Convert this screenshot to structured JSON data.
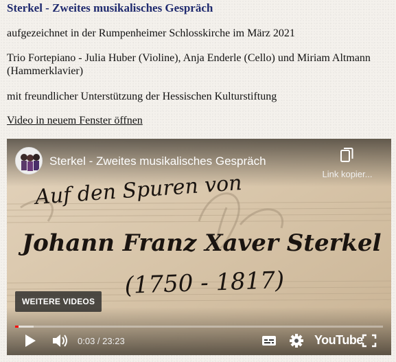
{
  "page": {
    "heading": "Sterkel - Zweites musikalisches Gespräch",
    "recorded": "aufgezeichnet in der Rumpenheimer Schlosskirche im März 2021",
    "performers": "Trio Fortepiano - Julia Huber (Violine), Anja Enderle (Cello) und Miriam Altmann (Hammerklavier)",
    "support": "mit freundlicher Unterstützung der Hessischen Kulturstiftung",
    "open_link": "Video in neuem Fenster öffnen"
  },
  "player": {
    "title": "Sterkel - Zweites musikalisches Gespräch",
    "share_label": "Link kopier...",
    "thumb_line1": "Auf den Spuren von",
    "thumb_line2": "Johann Franz Xaver Sterkel",
    "thumb_line3": "(1750 - 1817)",
    "more_videos": "WEITERE VIDEOS",
    "time": "0:03 / 23:23",
    "logo": "YouTube",
    "progress_played": 0.01,
    "progress_buffered": 0.05,
    "icons": [
      "play-icon",
      "volume-icon",
      "subtitles-icon",
      "settings-icon",
      "fullscreen-icon",
      "copy-link-icon"
    ],
    "accent": "#ff0000"
  }
}
